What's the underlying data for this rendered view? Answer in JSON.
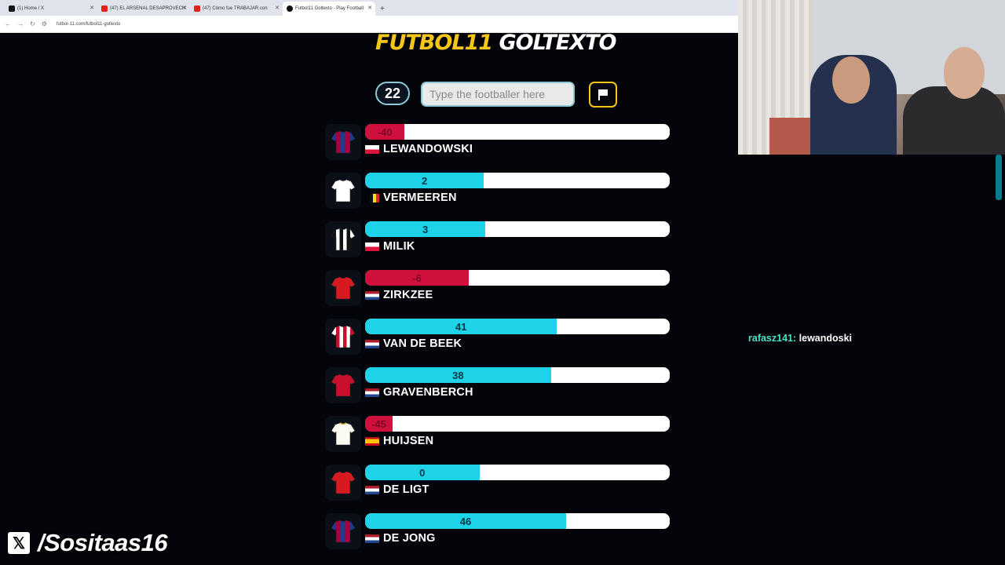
{
  "browser": {
    "tabs": [
      {
        "title": "(1) Home / X",
        "favicon_color": "#111111",
        "active": false
      },
      {
        "title": "(47) EL ARSENAL DESAPROVECH",
        "favicon_color": "#e62117",
        "active": false
      },
      {
        "title": "(47) Cómo fue TRABAJAR con ",
        "favicon_color": "#e62117",
        "active": false
      },
      {
        "title": "Futbol11 Goltexto - Play Football",
        "favicon_color": "#111111",
        "active": true
      }
    ],
    "url": "futbol-11.com/futbol11-goltexto"
  },
  "game": {
    "logo_part1": "FUTBOL11",
    "logo_part2": "GOLTEXTO",
    "guess_count": "22",
    "search_placeholder": "Type the footballer here",
    "players": [
      {
        "name": "LEWANDOWSKI",
        "value": "-40",
        "sign": "neg",
        "fill": 0.13,
        "country": "pl",
        "jersey": "barca"
      },
      {
        "name": "VERMEEREN",
        "value": "2",
        "sign": "pos",
        "fill": 0.39,
        "country": "be",
        "jersey": "white"
      },
      {
        "name": "MILIK",
        "value": "3",
        "sign": "pos",
        "fill": 0.395,
        "country": "pl",
        "jersey": "juve"
      },
      {
        "name": "ZIRKZEE",
        "value": "-6",
        "sign": "neg",
        "fill": 0.34,
        "country": "nl",
        "jersey": "red"
      },
      {
        "name": "VAN DE BEEK",
        "value": "41",
        "sign": "pos",
        "fill": 0.63,
        "country": "nl",
        "jersey": "ajax"
      },
      {
        "name": "GRAVENBERCH",
        "value": "38",
        "sign": "pos",
        "fill": 0.61,
        "country": "nl",
        "jersey": "liverpool"
      },
      {
        "name": "HUIJSEN",
        "value": "-45",
        "sign": "neg",
        "fill": 0.09,
        "country": "es",
        "jersey": "madrid"
      },
      {
        "name": "DE LIGT",
        "value": "0",
        "sign": "pos",
        "fill": 0.375,
        "country": "nl",
        "jersey": "manutd"
      },
      {
        "name": "DE JONG",
        "value": "46",
        "sign": "pos",
        "fill": 0.66,
        "country": "nl",
        "jersey": "barca"
      }
    ]
  },
  "chat": {
    "user": "rafasz141:",
    "message": "lewandoski"
  },
  "overlay": {
    "social_handle": "/Sositaas16"
  },
  "colors": {
    "positive": "#1ed3e8",
    "negative": "#d0103c",
    "accent": "#f5c518"
  }
}
